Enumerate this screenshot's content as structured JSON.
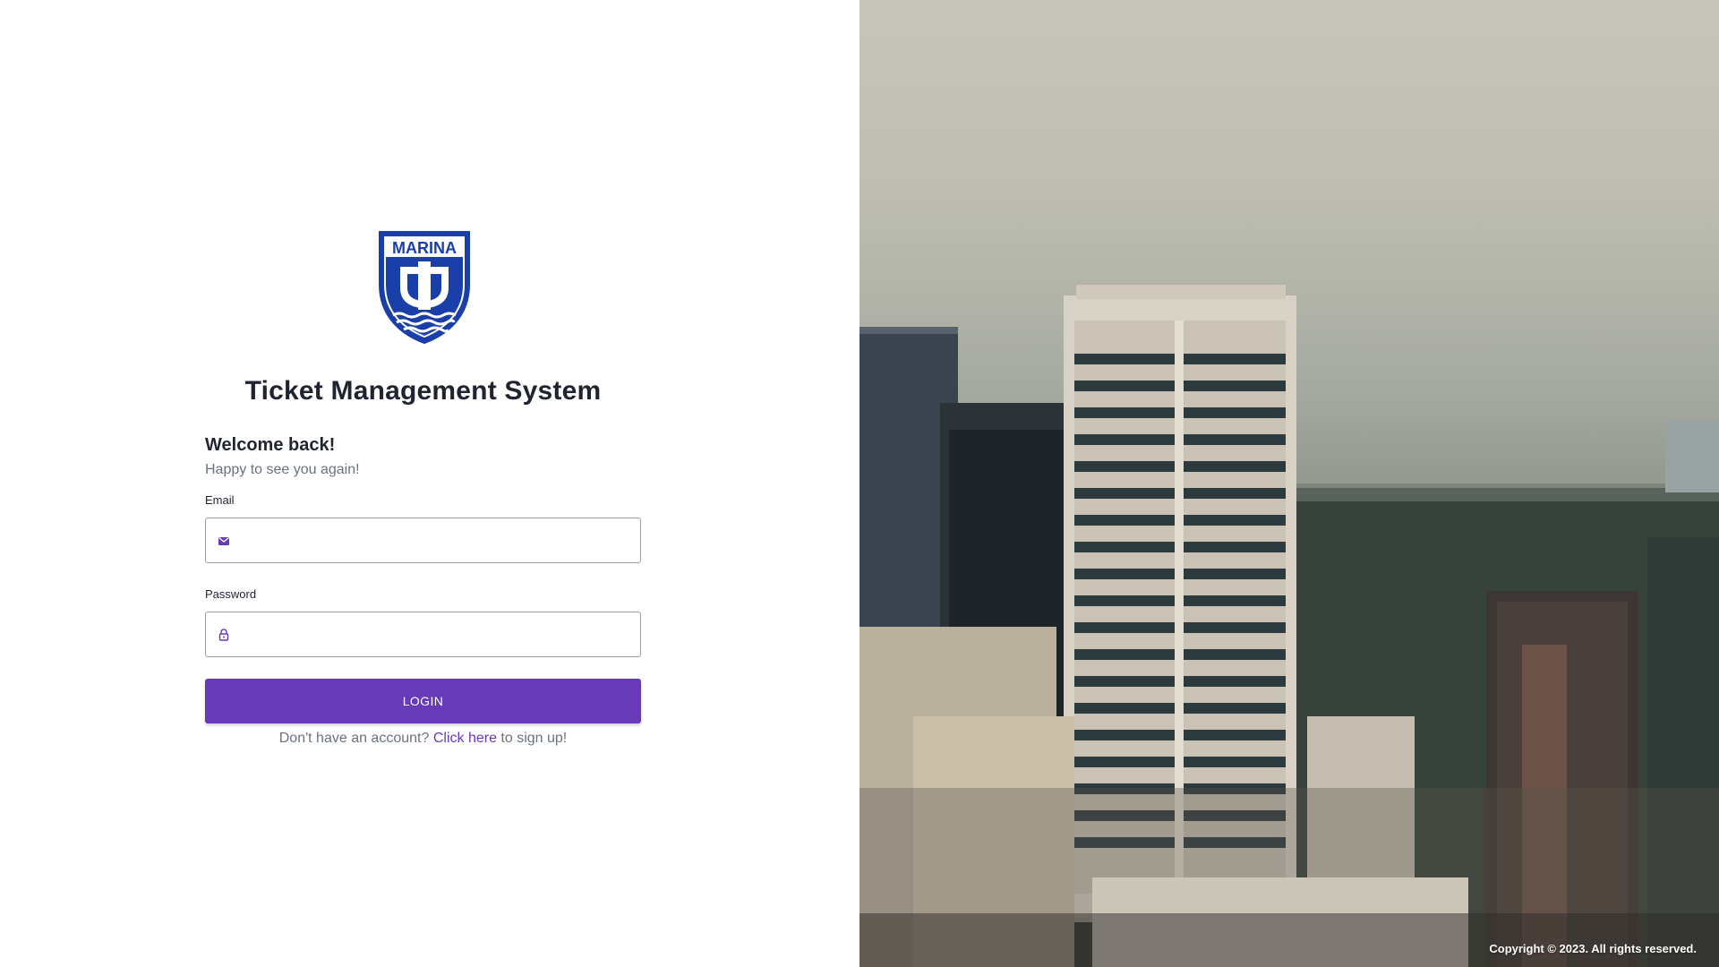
{
  "app": {
    "title": "Ticket Management System",
    "logo_text": "MARINA",
    "brand_color": "#673ab7",
    "logo_color": "#1a3fa8"
  },
  "login": {
    "welcome": "Welcome back!",
    "subtitle": "Happy to see you again!",
    "email": {
      "label": "Email",
      "value": "",
      "placeholder": "",
      "icon": "mail-icon"
    },
    "password": {
      "label": "Password",
      "value": "",
      "placeholder": "",
      "icon": "lock-icon"
    },
    "button_label": "LOGIN",
    "signup_prefix": "Don't have an account?",
    "signup_link": "Click here",
    "signup_suffix": "to sign up!"
  },
  "footer": {
    "copyright": "Copyright © 2023. All rights reserved."
  }
}
